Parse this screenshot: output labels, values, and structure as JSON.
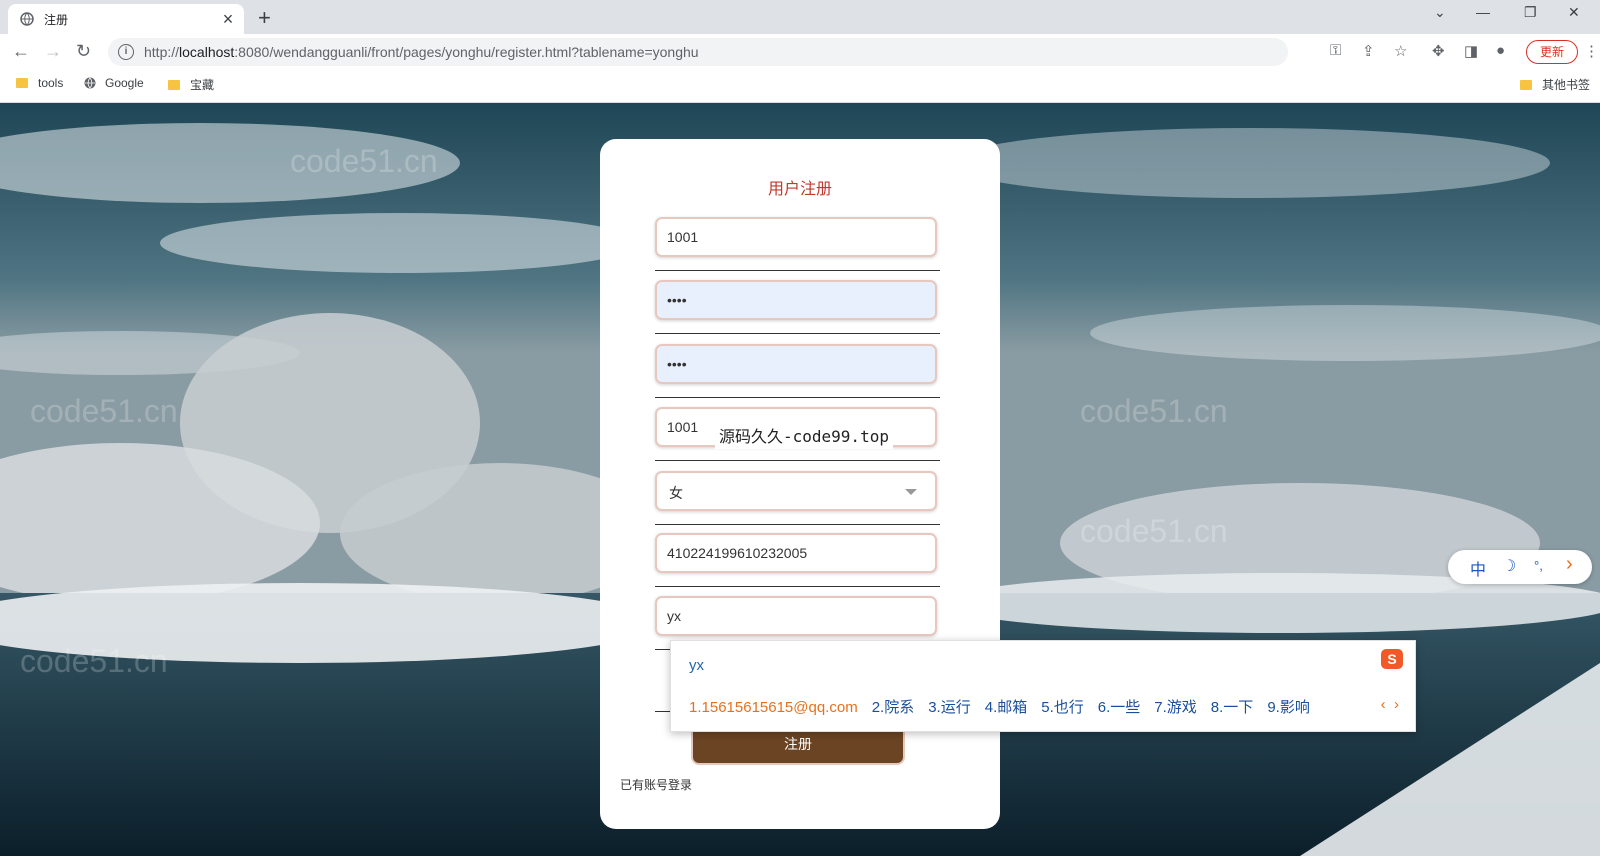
{
  "browser": {
    "tab_title": "注册",
    "tab_close": "×",
    "new_tab": "+",
    "window_controls": [
      "⌄",
      "—",
      "❐",
      "✕"
    ],
    "url_prefix": "http://",
    "url_host": "localhost",
    "url_rest": ":8080/wendangguanli/front/pages/yonghu/register.html?tablename=yonghu",
    "update_label": "更新",
    "bookmarks": [
      "tools",
      "Google",
      "宝藏"
    ],
    "other_bookmarks": "其他书签"
  },
  "form": {
    "title": "用户注册",
    "account": "1001",
    "password": "••••",
    "confirm_password": "••••",
    "name": "1001",
    "overlay": "源码久久-code99.top",
    "gender": "女",
    "id_number": "410224199610232005",
    "email_typing": "yx",
    "submit_label": "注册",
    "login_link": "已有账号登录"
  },
  "ime": {
    "composition": "yx",
    "logo": "S",
    "candidates": [
      "1.15615615615@qq.com",
      "2.院系",
      "3.运行",
      "4.邮箱",
      "5.也行",
      "6.一些",
      "7.游戏",
      "8.一下",
      "9.影响"
    ],
    "prev": "‹",
    "next": "›"
  },
  "ime_bar": {
    "lang": "中",
    "moon": "☽",
    "punct": "°,",
    "arrow": "›"
  },
  "watermark": "code51.cn",
  "colors": {
    "title_red": "#c0392b",
    "submit_brown": "#6b4423",
    "field_border": "#e7c8bf",
    "autofill_blue": "#e8f0fe"
  }
}
